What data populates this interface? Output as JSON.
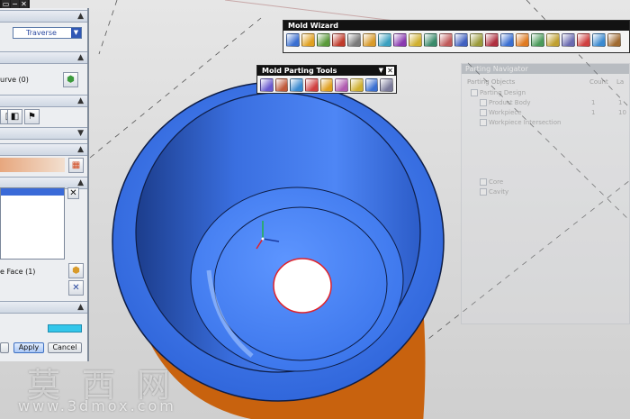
{
  "left_dialog": {
    "method_value": "Traverse",
    "curve_label": "urve (0)",
    "face_label": "e Face (1)",
    "apply_label": "Apply",
    "cancel_label": "Cancel"
  },
  "mold_wizard": {
    "title": "Mold Wizard",
    "icon_colors": [
      "#3a6fd1",
      "#e0a020",
      "#5a9a3a",
      "#c03a2a",
      "#7a7a7a",
      "#d89a2a",
      "#3aa0c0",
      "#8a3ab0",
      "#d0b030",
      "#3a8a6a",
      "#c05a5a",
      "#4060c0",
      "#9a9a3a",
      "#b03040",
      "#3a6fd1",
      "#e07a20",
      "#4a9a5a",
      "#c0a030",
      "#6a6ab0",
      "#d04040",
      "#3a8ad0",
      "#a06a30"
    ]
  },
  "parting_tools": {
    "title": "Mold Parting Tools",
    "icon_colors": [
      "#6a5ad0",
      "#c05a3a",
      "#3a8ad0",
      "#d04040",
      "#e0a020",
      "#b05ab0",
      "#d0b030",
      "#3a6fd1",
      "#7a7a9a"
    ]
  },
  "parting_navigator": {
    "title": "Parting Navigator",
    "columns": [
      "Parting Objects",
      "Count",
      "La"
    ],
    "items": [
      {
        "label": "Parting Design",
        "count": "",
        "layer": ""
      },
      {
        "label": "Product Body",
        "count": "1",
        "layer": "1"
      },
      {
        "label": "Workpiece",
        "count": "1",
        "layer": "10"
      },
      {
        "label": "Workpiece Intersection",
        "count": "",
        "layer": ""
      },
      {
        "label": "Core",
        "count": "",
        "layer": ""
      },
      {
        "label": "Cavity",
        "count": "",
        "layer": ""
      }
    ]
  },
  "watermark": {
    "cn": "莫西网",
    "url": "www.3dmox.com"
  },
  "colors": {
    "part_blue": "#3a78ee",
    "part_dark": "#1c3d8c",
    "part_orange": "#c8620e",
    "toolbar_title_bg": "#121212",
    "selection_blue": "#3a6ad8"
  }
}
